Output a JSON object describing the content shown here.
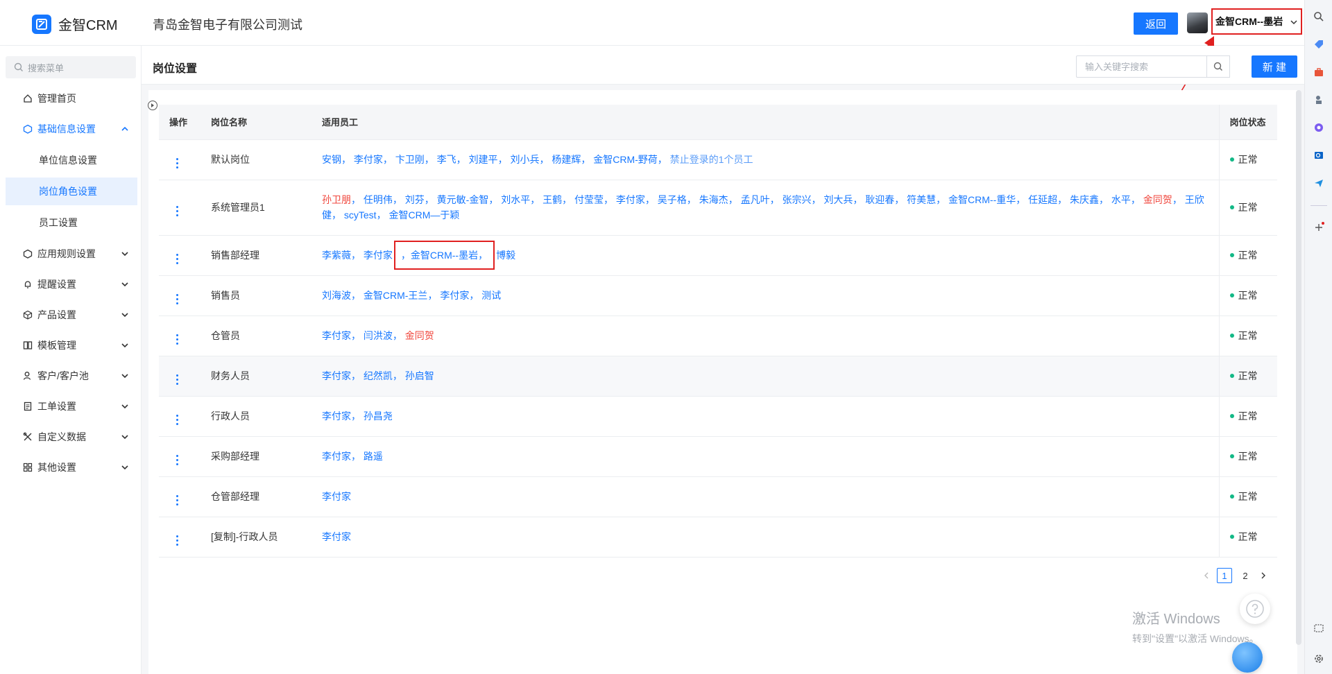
{
  "app": {
    "brand": "金智CRM",
    "company": "青岛金智电子有限公司测试",
    "back_label": "返回",
    "current_user": "金智CRM--墨岩"
  },
  "sidebar": {
    "search_placeholder": "搜索菜单",
    "items": [
      {
        "label": "管理首页",
        "icon": "home-icon"
      },
      {
        "label": "基础信息设置",
        "icon": "cube-icon",
        "expanded": true
      },
      {
        "label": "应用规则设置",
        "icon": "cube-icon"
      },
      {
        "label": "提醒设置",
        "icon": "bell-icon"
      },
      {
        "label": "产品设置",
        "icon": "box-icon"
      },
      {
        "label": "模板管理",
        "icon": "template-icon"
      },
      {
        "label": "客户/客户池",
        "icon": "user-icon"
      },
      {
        "label": "工单设置",
        "icon": "doc-icon"
      },
      {
        "label": "自定义数据",
        "icon": "tools-icon"
      },
      {
        "label": "其他设置",
        "icon": "grid-icon"
      }
    ],
    "sub_items": [
      {
        "label": "单位信息设置"
      },
      {
        "label": "岗位角色设置",
        "selected": true
      },
      {
        "label": "员工设置"
      }
    ]
  },
  "panel": {
    "title": "岗位设置",
    "search_placeholder": "输入关键字搜索",
    "new_label": "新 建"
  },
  "table": {
    "headers": {
      "op": "操作",
      "name": "岗位名称",
      "employees": "适用员工",
      "status": "岗位状态"
    },
    "rows": [
      {
        "name": "默认岗位",
        "status": "正常"
      },
      {
        "name": "系统管理员1",
        "status": "正常"
      },
      {
        "name": "销售部经理",
        "status": "正常"
      },
      {
        "name": "销售员",
        "status": "正常"
      },
      {
        "name": "仓管员",
        "status": "正常"
      },
      {
        "name": "财务人员",
        "status": "正常"
      },
      {
        "name": "行政人员",
        "status": "正常"
      },
      {
        "name": "采购部经理",
        "status": "正常"
      },
      {
        "name": "仓管部经理",
        "status": "正常"
      },
      {
        "name": "[复制]-行政人员",
        "status": "正常"
      }
    ],
    "employees": {
      "r0": [
        "安钢",
        "李付家",
        "卞卫刚",
        "李飞",
        "刘建平",
        "刘小兵",
        "杨建辉",
        "金智CRM-野荷",
        "禁止登录的1个员工"
      ],
      "r1": [
        "孙卫朋",
        "任明伟",
        "刘芬",
        "黄元敏-金智",
        "刘水平",
        "王鹤",
        "付莹莹",
        "李付家",
        "吴子格",
        "朱海杰",
        "孟凡叶",
        "张宗兴",
        "刘大兵",
        "耿迎春",
        "符美慧",
        "金智CRM--重华",
        "任延超",
        "朱庆鑫",
        "水平",
        "金同贺",
        "王欣健",
        "scyTest",
        "金智CRM—于颖"
      ],
      "r2": [
        "李紫薇",
        "李付家",
        "金智CRM--墨岩",
        "博毅"
      ],
      "r3": [
        "刘海波",
        "金智CRM-王兰",
        "李付家",
        "测试"
      ],
      "r4": [
        "李付家",
        "闫洪波",
        "金同贺"
      ],
      "r5": [
        "李付家",
        "纪然凯",
        "孙启智"
      ],
      "r6": [
        "李付家",
        "孙昌尧"
      ],
      "r7": [
        "李付家",
        "路遥"
      ],
      "r8": [
        "李付家"
      ],
      "r9": [
        "李付家"
      ]
    }
  },
  "pager": {
    "prev": "‹",
    "pages": [
      "1",
      "2"
    ],
    "current": "1",
    "next": "›"
  },
  "watermark": {
    "title": "激活 Windows",
    "sub": "转到\"设置\"以激活 Windows。"
  },
  "colors": {
    "accent": "#1677ff",
    "danger": "#f0463c",
    "status_ok": "#12b886",
    "annotation": "#e02020"
  }
}
